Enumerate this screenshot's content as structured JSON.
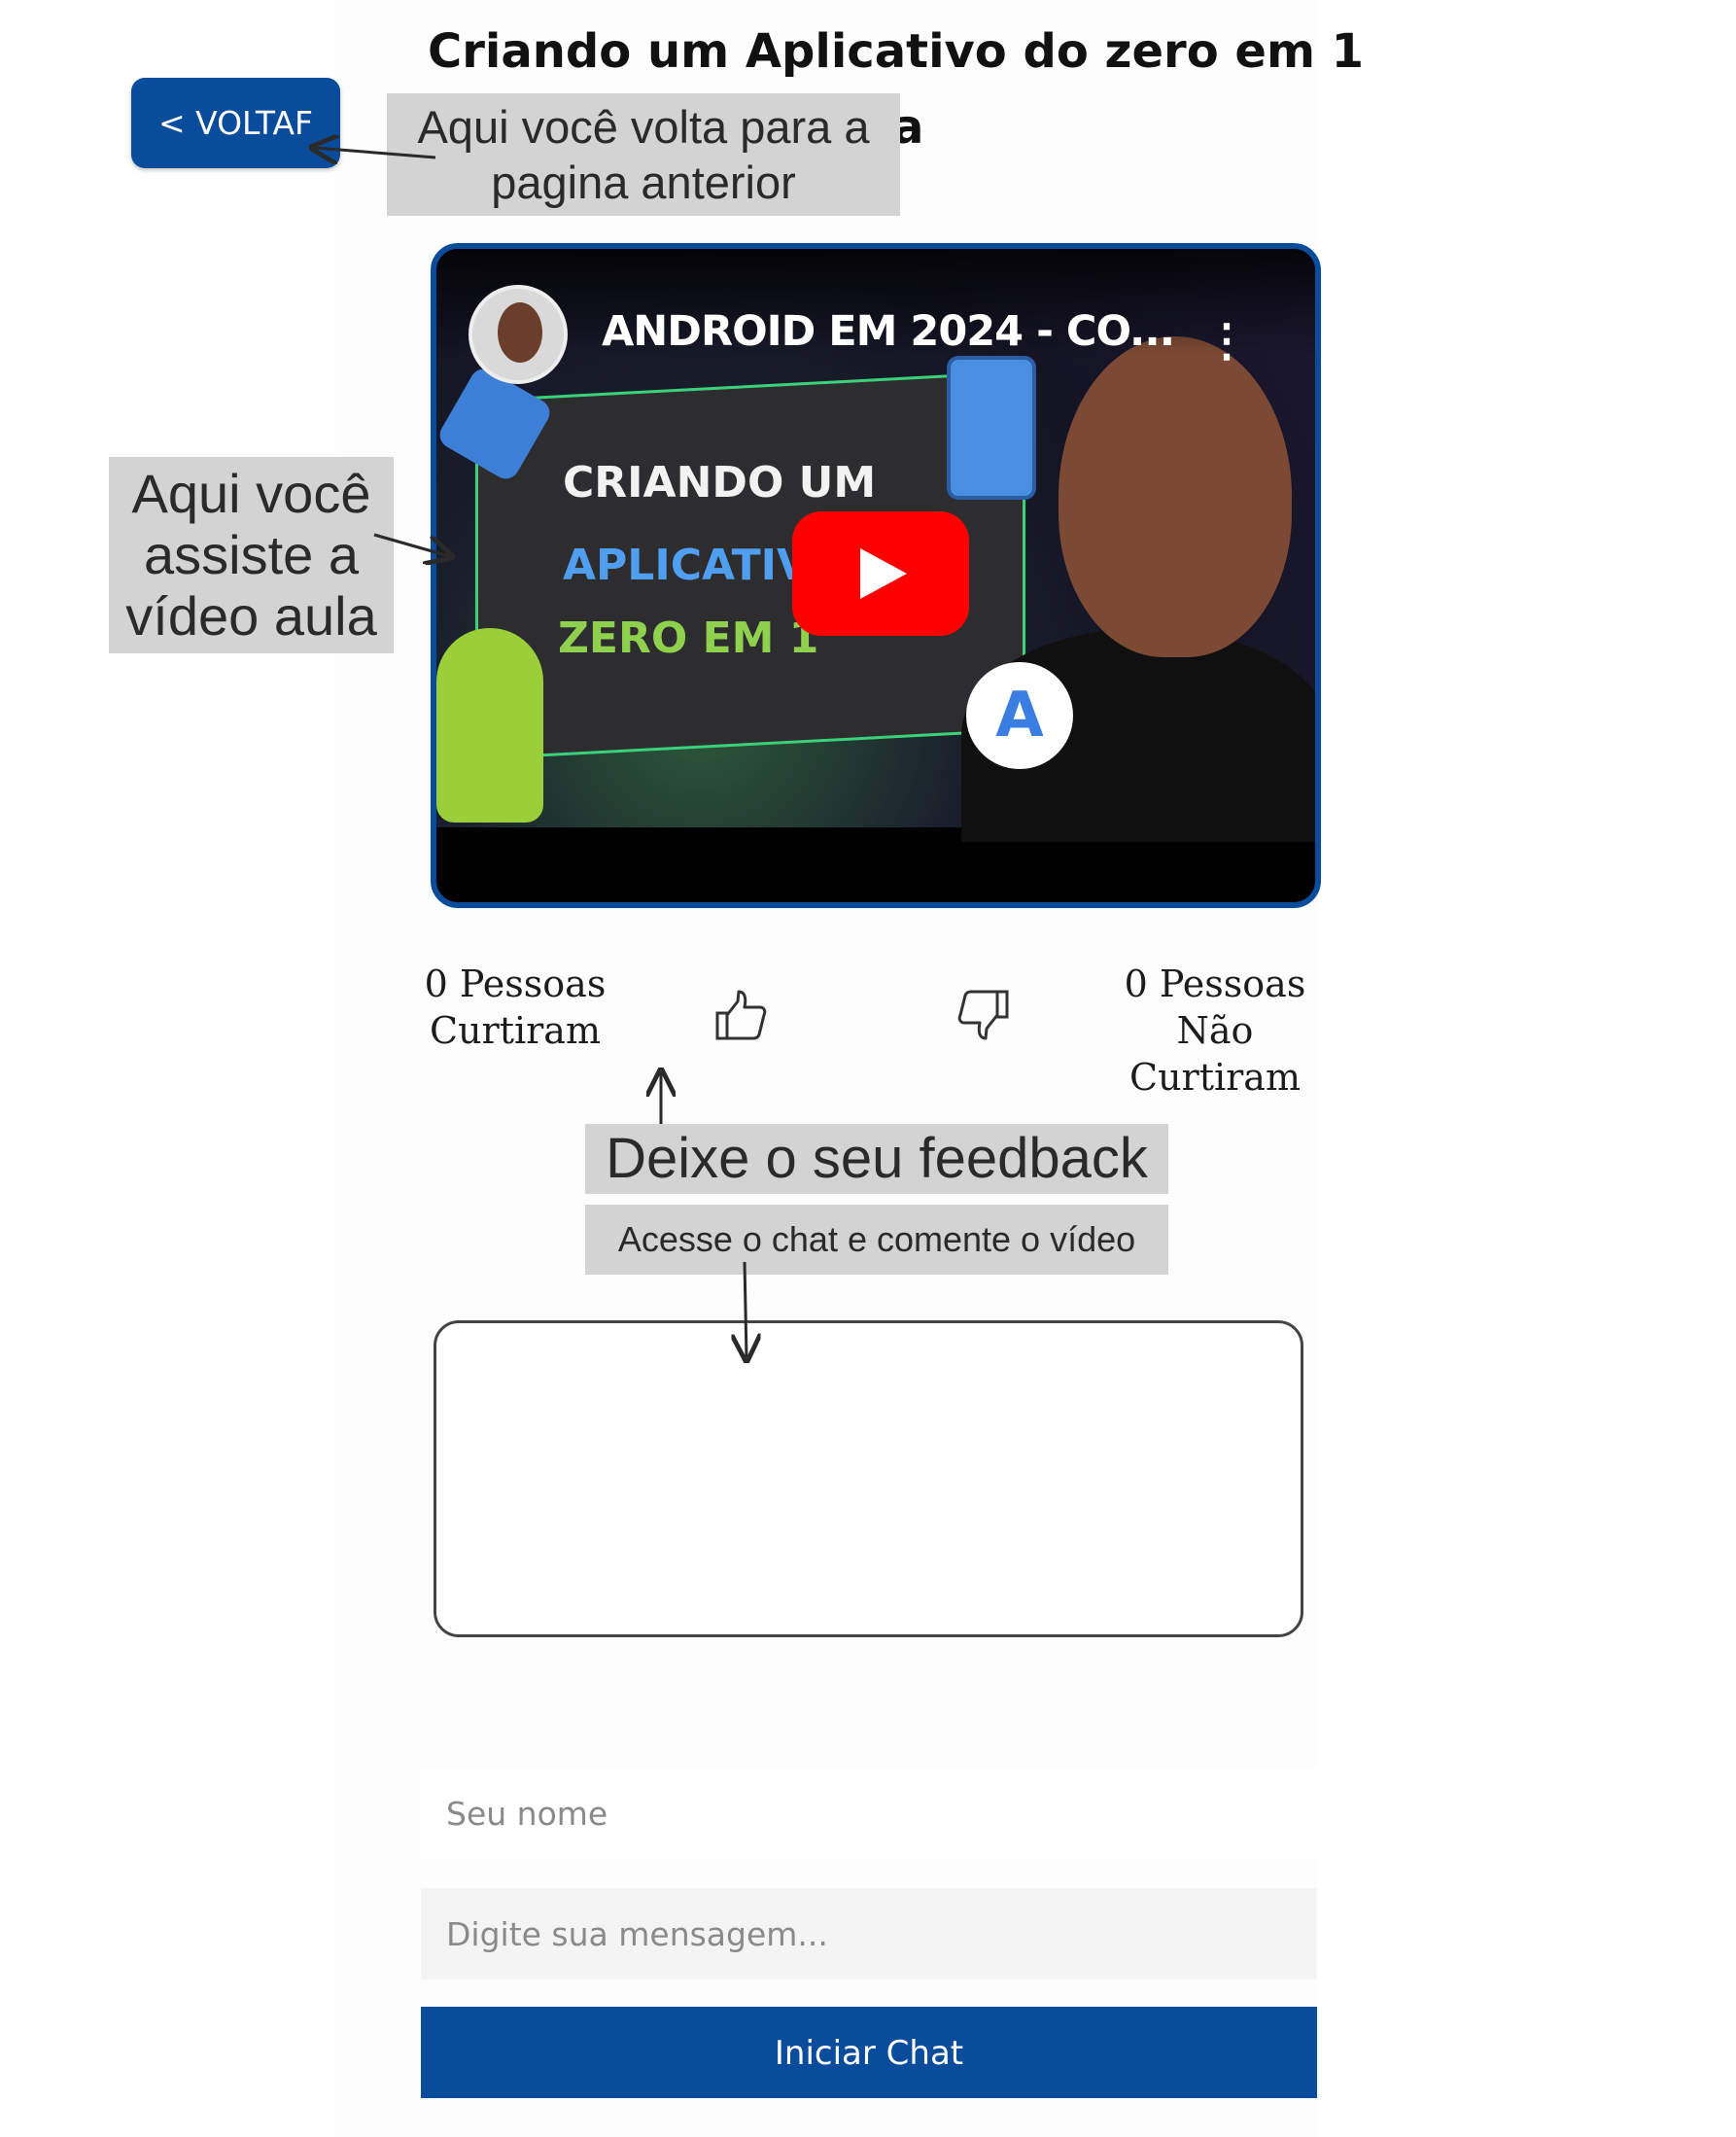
{
  "page": {
    "title_line1": "Criando um Aplicativo do zero em 1",
    "title_line2": "a"
  },
  "back_button": {
    "label": "< VOLTAF"
  },
  "video": {
    "title": "ANDROID EM 2024 - CO...",
    "thumbnail_text": [
      "CRIANDO UM",
      "APLICATIV",
      "ZERO EM 1"
    ],
    "thumbnail_icon": "A"
  },
  "feedback": {
    "likes_text": [
      "0 Pessoas",
      "Curtiram"
    ],
    "dislikes_text": [
      "0 Pessoas",
      "Não",
      "Curtiram"
    ]
  },
  "annotations": {
    "back": [
      "Aqui você volta para a",
      "pagina anterior"
    ],
    "video": [
      "Aqui você",
      "assiste a",
      "vídeo aula"
    ],
    "feedback": "Deixe o seu feedback",
    "chat": "Acesse o chat e comente o vídeo"
  },
  "chat": {
    "name_placeholder": "Seu nome",
    "message_placeholder": "Digite sua mensagem...",
    "start_label": "Iniciar Chat"
  },
  "colors": {
    "primary": "#0a4c9c",
    "annotation_bg": "#d3d3d4",
    "youtube_red": "#ff0000"
  }
}
